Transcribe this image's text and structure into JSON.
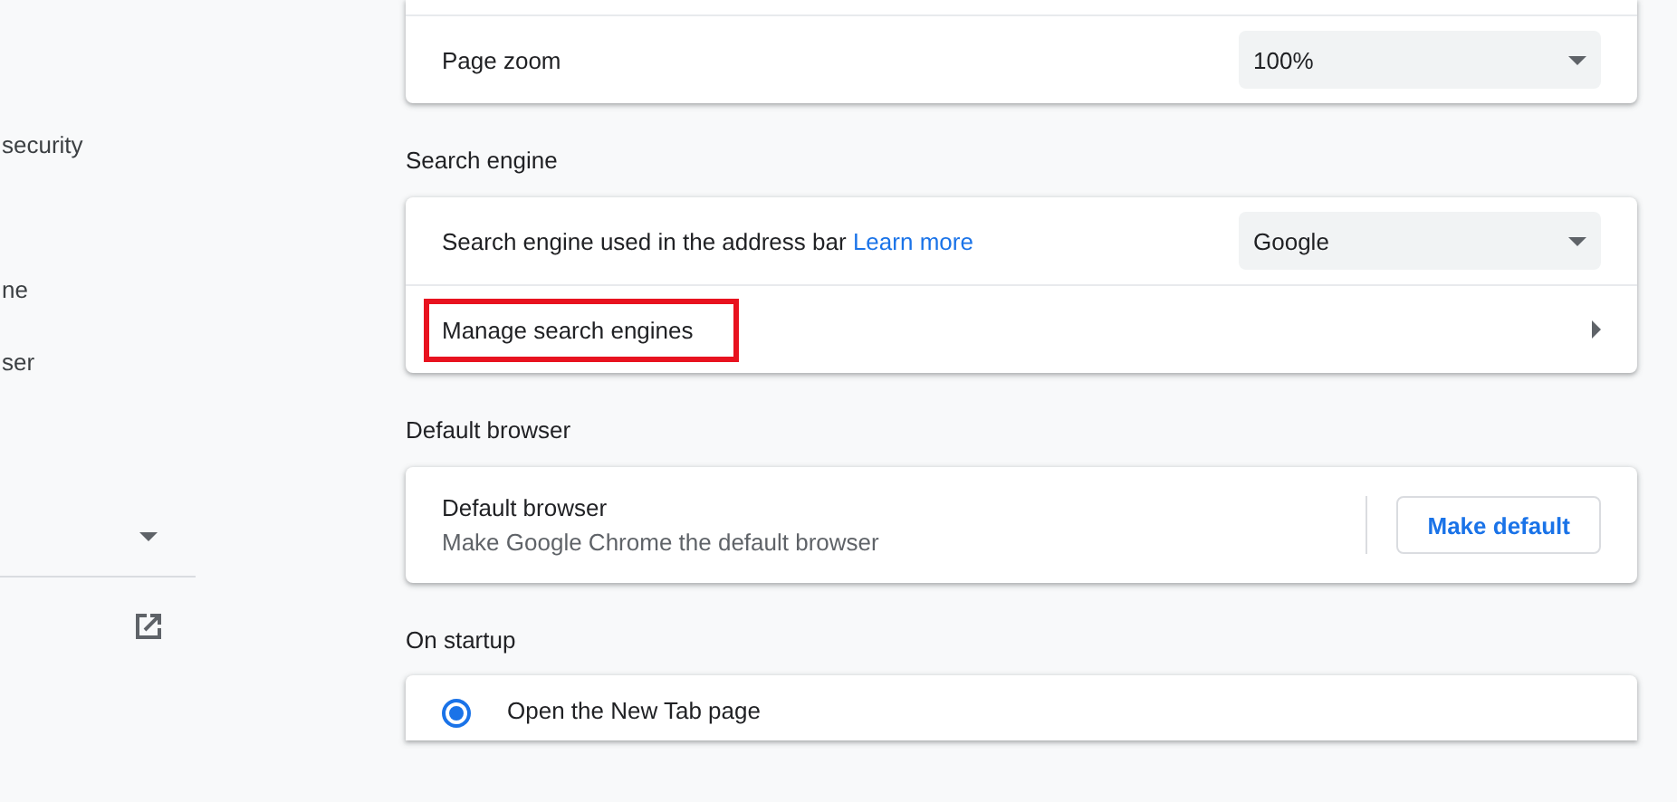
{
  "sidebar": {
    "items": [
      {
        "label": "security"
      },
      {
        "label": "ne"
      },
      {
        "label": "ser"
      }
    ]
  },
  "appearance": {
    "page_zoom": {
      "label": "Page zoom",
      "value": "100%"
    }
  },
  "search_engine": {
    "heading": "Search engine",
    "engine_row": {
      "label": "Search engine used in the address bar",
      "link": "Learn more",
      "value": "Google"
    },
    "manage_row": {
      "label": "Manage search engines",
      "highlighted": true
    }
  },
  "default_browser": {
    "heading": "Default browser",
    "title": "Default browser",
    "subtitle": "Make Google Chrome the default browser",
    "button": "Make default"
  },
  "on_startup": {
    "heading": "On startup",
    "options": [
      {
        "label": "Open the New Tab page",
        "selected": true
      }
    ]
  }
}
